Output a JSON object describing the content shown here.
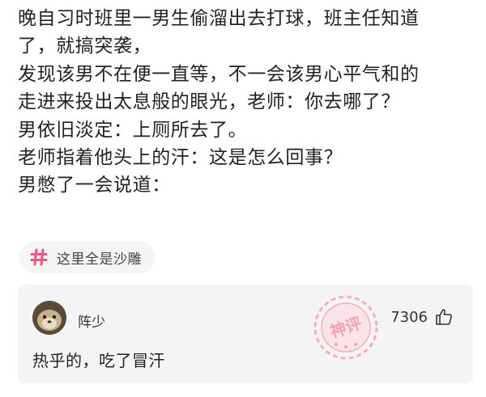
{
  "post": {
    "lines": [
      "晚自习时班里一男生偷溜出去打球，班主任知道",
      "了，就搞突袭，",
      "发现该男不在便一直等，不一会该男心平气和的",
      "走进来投出太息般的眼光，老师：你去哪了？",
      "男依旧淡定：上厕所去了。",
      "老师指着他头上的汗：这是怎么回事？",
      "男憋了一会说道："
    ]
  },
  "topic_tag": {
    "icon": "hash-icon",
    "label": "这里全是沙雕",
    "accent_color": "#f0557f"
  },
  "comment": {
    "author": "阵少",
    "text": "热乎的，吃了冒汗",
    "like_count": "7306",
    "like_icon": "thumbs-up-icon",
    "stamp_text": "神评",
    "stamp_color": "#f7a7b6"
  }
}
